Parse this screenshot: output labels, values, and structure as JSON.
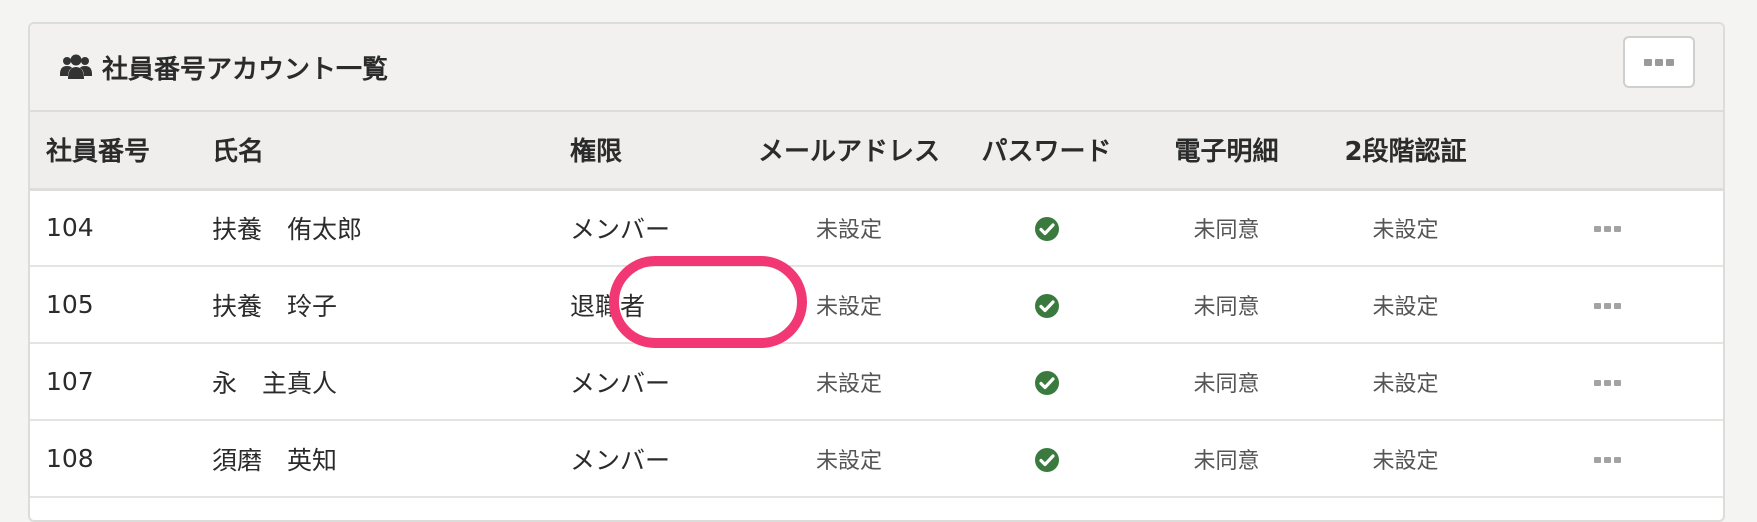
{
  "panel": {
    "title": "社員番号アカウント一覧",
    "icon": "users-icon"
  },
  "table": {
    "headers": {
      "employee_no": "社員番号",
      "name": "氏名",
      "role": "権限",
      "email": "メールアドレス",
      "password": "パスワード",
      "e_statement": "電子明細",
      "two_factor": "2段階認証"
    },
    "rows": [
      {
        "employee_no": "104",
        "name": "扶養　侑太郎",
        "role": "メンバー",
        "email": "未設定",
        "password": "check-circle-icon",
        "e_statement": "未同意",
        "two_factor": "未設定"
      },
      {
        "employee_no": "105",
        "name": "扶養　玲子",
        "role": "退職者",
        "email": "未設定",
        "password": "check-circle-icon",
        "e_statement": "未同意",
        "two_factor": "未設定"
      },
      {
        "employee_no": "107",
        "name": "永　主真人",
        "role": "メンバー",
        "email": "未設定",
        "password": "check-circle-icon",
        "e_statement": "未同意",
        "two_factor": "未設定"
      },
      {
        "employee_no": "108",
        "name": "須磨　英知",
        "role": "メンバー",
        "email": "未設定",
        "password": "check-circle-icon",
        "e_statement": "未同意",
        "two_factor": "未設定"
      }
    ]
  },
  "colors": {
    "check": "#3a7a3e",
    "highlight": "#f23775"
  }
}
